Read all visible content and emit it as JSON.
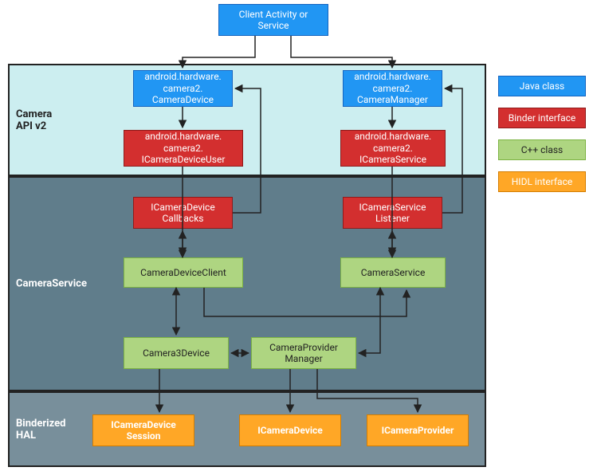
{
  "bands": {
    "api": "Camera\nAPI v2",
    "svc": "CameraService",
    "hal": "Binderized\nHAL"
  },
  "nodes": {
    "client": "Client Activity or\nService",
    "camDevice": "android.hardware.\ncamera2.\nCameraDevice",
    "camManager": "android.hardware.\ncamera2.\nCameraManager",
    "iUser": "android.hardware.\ncamera2.\nICameraDeviceUser",
    "iService": "android.hardware.\ncamera2.\nICameraService",
    "iCallbacks": "ICameraDevice\nCallbacks",
    "iListener": "ICameraService\nListener",
    "devClient": "CameraDeviceClient",
    "camService": "CameraService",
    "cam3Device": "Camera3Device",
    "provMgr": "CameraProvider\nManager",
    "hidlSession": "ICameraDevice\nSession",
    "hidlDevice": "ICameraDevice",
    "hidlProvider": "ICameraProvider"
  },
  "legend": {
    "java": "Java class",
    "binder": "Binder interface",
    "cpp": "C++ class",
    "hidl": "HIDL interface"
  },
  "chart_data": {
    "type": "diagram",
    "title": "Android Camera Architecture",
    "layers": [
      {
        "name": "Camera API v2",
        "color": "#cceef0"
      },
      {
        "name": "CameraService",
        "color": "#607d8b"
      },
      {
        "name": "Binderized HAL",
        "color": "#788f9b"
      }
    ],
    "legend": [
      {
        "label": "Java class",
        "color": "#2196f3"
      },
      {
        "label": "Binder interface",
        "color": "#d32f2f"
      },
      {
        "label": "C++ class",
        "color": "#aed581"
      },
      {
        "label": "HIDL interface",
        "color": "#ffa726"
      }
    ],
    "nodes": [
      {
        "id": "client",
        "label": "Client Activity or Service",
        "kind": "java",
        "layer": null
      },
      {
        "id": "camDevice",
        "label": "android.hardware.camera2.CameraDevice",
        "kind": "java",
        "layer": "Camera API v2"
      },
      {
        "id": "camManager",
        "label": "android.hardware.camera2.CameraManager",
        "kind": "java",
        "layer": "Camera API v2"
      },
      {
        "id": "iUser",
        "label": "android.hardware.camera2.ICameraDeviceUser",
        "kind": "binder",
        "layer": "Camera API v2"
      },
      {
        "id": "iService",
        "label": "android.hardware.camera2.ICameraService",
        "kind": "binder",
        "layer": "Camera API v2"
      },
      {
        "id": "iCallbacks",
        "label": "ICameraDeviceCallbacks",
        "kind": "binder",
        "layer": "CameraService"
      },
      {
        "id": "iListener",
        "label": "ICameraServiceListener",
        "kind": "binder",
        "layer": "CameraService"
      },
      {
        "id": "devClient",
        "label": "CameraDeviceClient",
        "kind": "cpp",
        "layer": "CameraService"
      },
      {
        "id": "camService",
        "label": "CameraService",
        "kind": "cpp",
        "layer": "CameraService"
      },
      {
        "id": "cam3Device",
        "label": "Camera3Device",
        "kind": "cpp",
        "layer": "CameraService"
      },
      {
        "id": "provMgr",
        "label": "CameraProviderManager",
        "kind": "cpp",
        "layer": "CameraService"
      },
      {
        "id": "hidlSession",
        "label": "ICameraDeviceSession",
        "kind": "hidl",
        "layer": "Binderized HAL"
      },
      {
        "id": "hidlDevice",
        "label": "ICameraDevice",
        "kind": "hidl",
        "layer": "Binderized HAL"
      },
      {
        "id": "hidlProvider",
        "label": "ICameraProvider",
        "kind": "hidl",
        "layer": "Binderized HAL"
      }
    ],
    "edges": [
      {
        "from": "client",
        "to": "camDevice",
        "dir": "one"
      },
      {
        "from": "client",
        "to": "camManager",
        "dir": "one"
      },
      {
        "from": "camDevice",
        "to": "iUser",
        "dir": "one"
      },
      {
        "from": "camManager",
        "to": "iService",
        "dir": "one"
      },
      {
        "from": "iUser",
        "to": "devClient",
        "dir": "one"
      },
      {
        "from": "iService",
        "to": "camService",
        "dir": "one"
      },
      {
        "from": "iCallbacks",
        "to": "camDevice",
        "dir": "one",
        "route": "up-right"
      },
      {
        "from": "iListener",
        "to": "camManager",
        "dir": "one",
        "route": "up-right"
      },
      {
        "from": "devClient",
        "to": "iCallbacks",
        "dir": "both"
      },
      {
        "from": "camService",
        "to": "iListener",
        "dir": "both"
      },
      {
        "from": "devClient",
        "to": "cam3Device",
        "dir": "both"
      },
      {
        "from": "camService",
        "to": "provMgr",
        "dir": "both"
      },
      {
        "from": "cam3Device",
        "to": "provMgr",
        "dir": "both"
      },
      {
        "from": "devClient",
        "to": "camService",
        "dir": "one",
        "route": "down-right"
      },
      {
        "from": "cam3Device",
        "to": "hidlSession",
        "dir": "one"
      },
      {
        "from": "provMgr",
        "to": "hidlDevice",
        "dir": "one"
      },
      {
        "from": "provMgr",
        "to": "hidlProvider",
        "dir": "one",
        "route": "down-right"
      }
    ]
  }
}
